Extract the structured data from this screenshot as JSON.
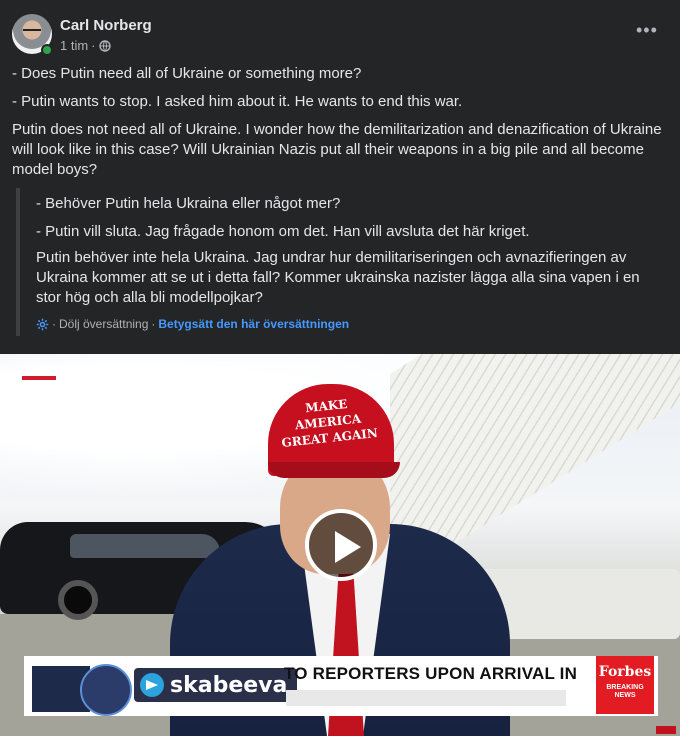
{
  "post": {
    "author": "Carl Norberg",
    "time": "1 tim",
    "separator": "·",
    "paragraphs": [
      "- Does Putin need all of Ukraine or something more?",
      "- Putin wants to stop. I asked him about it. He wants to end this war.",
      "Putin does not need all of Ukraine. I wonder how the demilitarization and denazification of Ukraine will look like in this case? Will Ukrainian Nazis put all their weapons in a big pile and all become model boys?"
    ]
  },
  "translation": {
    "paragraphs": [
      "- Behöver Putin hela Ukraina eller något mer?",
      "- Putin vill sluta. Jag frågade honom om det. Han vill avsluta det här kriget.",
      "Putin behöver inte hela Ukraina. Jag undrar hur demilitariseringen och avnazifieringen av Ukraina kommer att se ut i detta fall? Kommer ukrainska nazister lägga alla sina vapen i en stor hög och alla bli modellpojkar?"
    ],
    "hide_link": "Dölj översättning",
    "rate_link": "Betygsätt den här översättningen",
    "separator": "·"
  },
  "video": {
    "cap_text": "MAKE AMERICA GREAT AGAIN",
    "banner_text": "TO REPORTERS UPON ARRIVAL IN",
    "channel_label": "skabeeva",
    "brand": "Forbes",
    "brand_sub": "BREAKING NEWS"
  },
  "icons": {
    "globe": "globe-icon",
    "more": "more-options-icon",
    "gear": "gear-icon",
    "play": "play-icon",
    "telegram": "telegram-icon"
  },
  "colors": {
    "background": "#242526",
    "link": "#4599ff",
    "online": "#31a24c"
  }
}
